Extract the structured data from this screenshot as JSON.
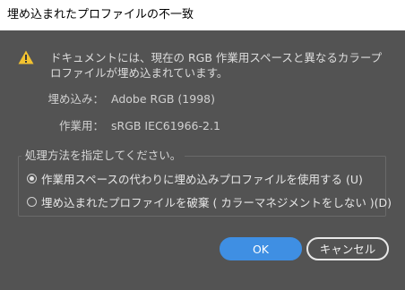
{
  "window": {
    "title": "埋め込まれたプロファイルの不一致"
  },
  "message": "ドキュメントには、現在の RGB 作業用スペースと異なるカラープロファイルが埋め込まれています。",
  "embedded": {
    "label": "埋め込み：",
    "value": "Adobe RGB (1998)"
  },
  "working": {
    "label": "作業用：",
    "value": "sRGB IEC61966-2.1"
  },
  "options": {
    "title": "処理方法を指定してください。",
    "items": [
      {
        "label": "作業用スペースの代わりに埋め込みプロファイルを使用する (U)",
        "checked": true
      },
      {
        "label": "埋め込まれたプロファイルを破棄 ( カラーマネジメントをしない )(D)",
        "checked": false
      }
    ]
  },
  "buttons": {
    "ok": "OK",
    "cancel": "キャンセル"
  },
  "colors": {
    "accent": "#3f8fe3",
    "warning": "#f2c230",
    "background": "#535353"
  }
}
